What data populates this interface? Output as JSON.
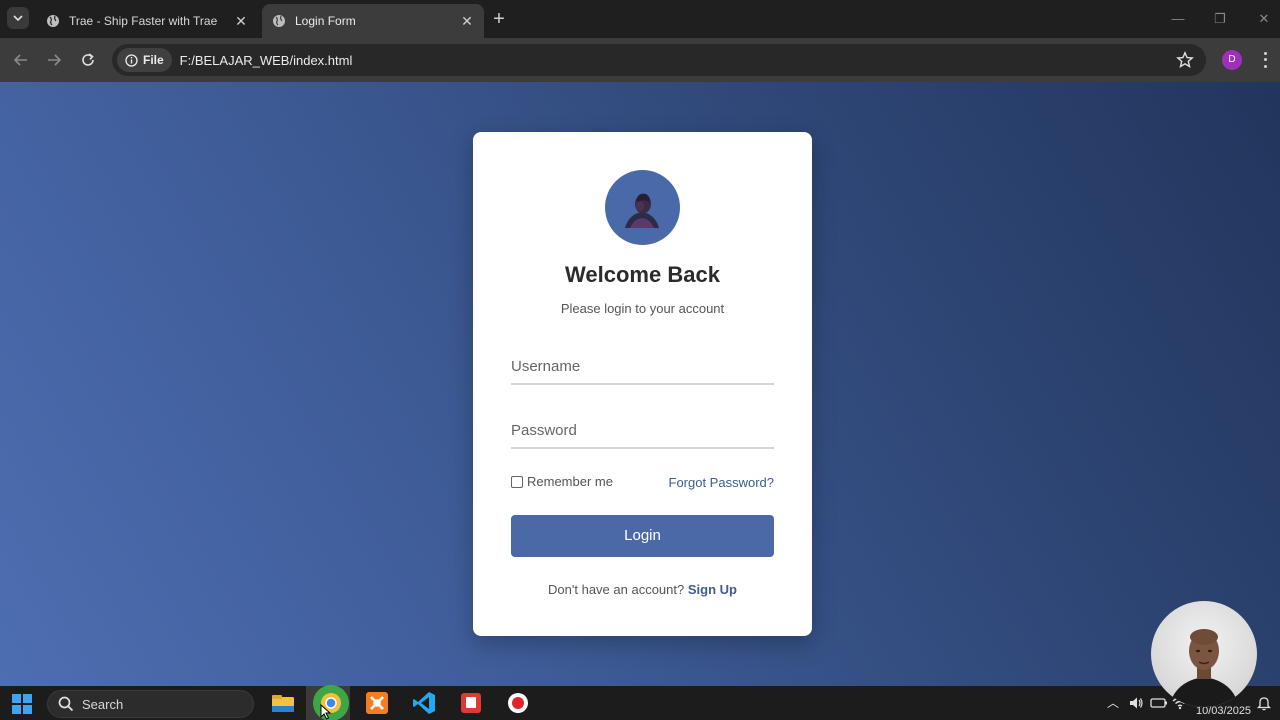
{
  "browser": {
    "tabs": [
      {
        "title": "Trae - Ship Faster with Trae",
        "active": false
      },
      {
        "title": "Login Form",
        "active": true
      }
    ],
    "site_chip": "File",
    "url": "F:/BELAJAR_WEB/index.html",
    "profile_initial": "D"
  },
  "login": {
    "title": "Welcome Back",
    "subtitle": "Please login to your account",
    "username_placeholder": "Username",
    "password_placeholder": "Password",
    "remember_label": "Remember me",
    "forgot_label": "Forgot Password?",
    "login_button": "Login",
    "signup_prompt": "Don't have an account?",
    "signup_link": "Sign Up"
  },
  "taskbar": {
    "search_label": "Search",
    "date": "10/03/2025"
  },
  "colors": {
    "accent": "#4b69a7",
    "link": "#3d5d93"
  }
}
